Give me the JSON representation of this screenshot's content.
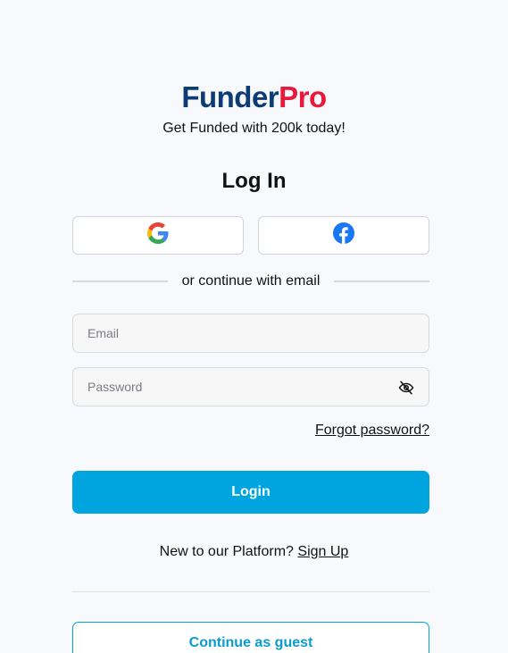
{
  "brand": {
    "logo_part1": "Funder",
    "logo_part2": "Pro",
    "tagline": "Get Funded with 200k today!",
    "primary_color": "#0d3b74",
    "accent_color": "#e8193c"
  },
  "form": {
    "title": "Log In",
    "social": {
      "google_icon": "google-icon",
      "facebook_icon": "facebook-icon"
    },
    "divider_text": "or continue with email",
    "email_placeholder": "Email",
    "password_placeholder": "Password",
    "password_toggle_icon": "eye-off-icon",
    "forgot_label": "Forgot password?",
    "login_label": "Login",
    "login_color": "#00a5e0",
    "signup_prompt": "New to our Platform?",
    "signup_link": "Sign Up",
    "guest_label": "Continue as guest"
  }
}
